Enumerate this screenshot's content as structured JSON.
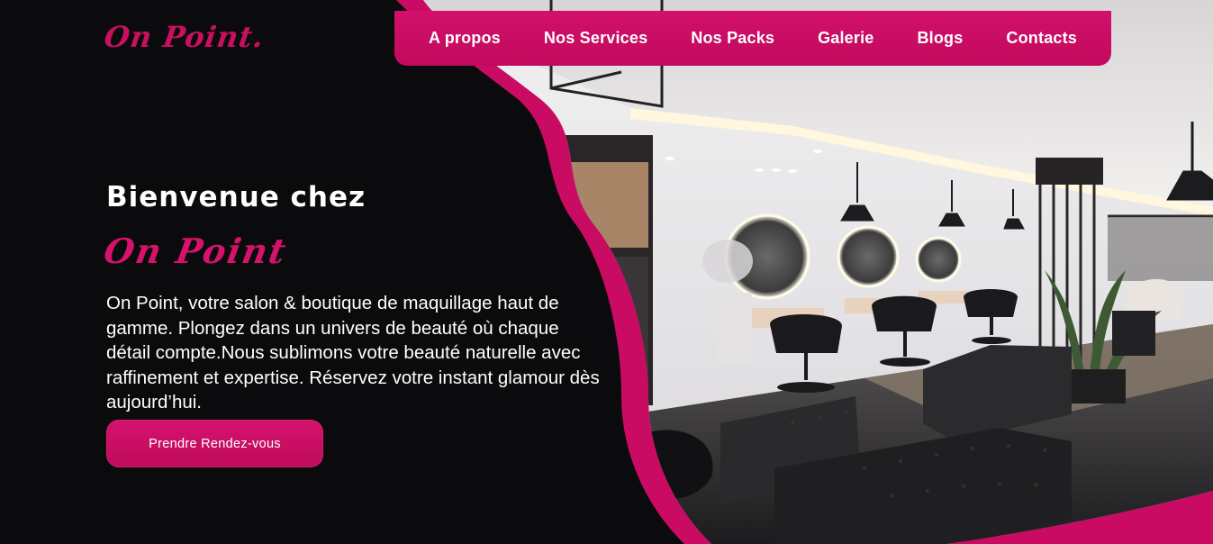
{
  "brand": {
    "logo_text": "On Point.",
    "accent_color": "#c8105f"
  },
  "nav": {
    "items": [
      {
        "label": "A propos"
      },
      {
        "label": "Nos Services"
      },
      {
        "label": "Nos Packs"
      },
      {
        "label": "Galerie"
      },
      {
        "label": "Blogs"
      },
      {
        "label": "Contacts"
      }
    ],
    "background_color": "#c90b63"
  },
  "hero": {
    "welcome": "Bienvenue chez",
    "brand_name": "On Point",
    "description": "On Point, votre salon & boutique de maquillage haut de gamme. Plongez dans un univers de beauté où chaque détail compte.Nous sublimons votre beauté naturelle avec raffinement et expertise. Réservez votre instant glamour dès aujourd’hui.",
    "cta_label": "Prendre Rendez-vous",
    "image_subject": "salon-interior-photo"
  }
}
